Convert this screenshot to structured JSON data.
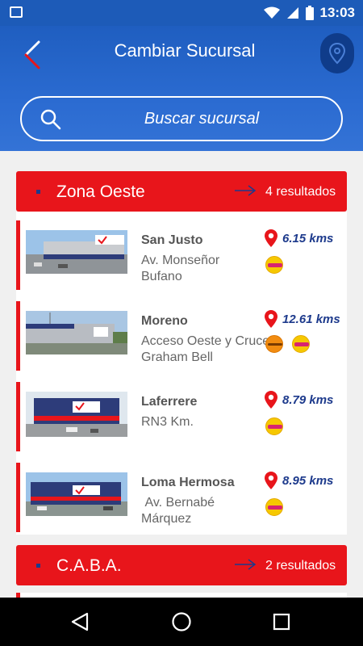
{
  "status_bar": {
    "time": "13:03",
    "icons": [
      "image-icon",
      "wifi-icon",
      "signal-icon",
      "battery-icon"
    ]
  },
  "header": {
    "title": "Cambiar Sucursal",
    "search_placeholder": "Buscar sucursal",
    "icons": [
      "back-icon",
      "location-pin-icon",
      "search-icon"
    ]
  },
  "colors": {
    "header_blue": "#2b6bd1",
    "zone_red": "#e8151b",
    "distance_blue": "#1d3a8c",
    "pin_red": "#e8151b"
  },
  "zones": [
    {
      "name": "Zona Oeste",
      "results": "4 resultados",
      "branches": [
        {
          "name": "San Justo",
          "address": "Av. Monseñor Bufano",
          "distance": "6.15 kms",
          "badges": [
            "promo-badge"
          ]
        },
        {
          "name": "Moreno",
          "address": "Acceso Oeste y Cruce Graham Bell",
          "distance": "12.61 kms",
          "badges": [
            "orange-badge",
            "promo-badge"
          ]
        },
        {
          "name": "Laferrere",
          "address": "RN3 Km.",
          "distance": "8.79 kms",
          "badges": [
            "promo-badge"
          ]
        },
        {
          "name": "Loma Hermosa",
          "address": " Av. Bernabé Márquez",
          "distance": "8.95 kms",
          "badges": [
            "promo-badge"
          ]
        }
      ]
    },
    {
      "name": "C.A.B.A.",
      "results": "2 resultados"
    }
  ],
  "nav_bar": {
    "icons": [
      "nav-back-icon",
      "nav-home-icon",
      "nav-recent-icon"
    ]
  }
}
